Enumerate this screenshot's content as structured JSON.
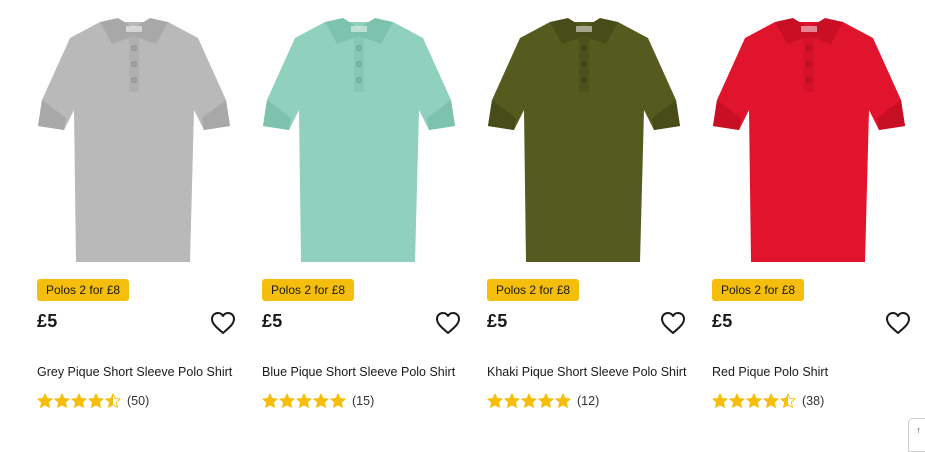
{
  "products": [
    {
      "image_alt": "Grey Pique Short Sleeve Polo Shirt",
      "shirt_color": "#b9b9b9",
      "shirt_shade": "#a8a8a8",
      "promo": "Polos 2 for £8",
      "price": "£5",
      "title": "Grey Pique Short Sleeve Polo Shirt",
      "rating": 4.5,
      "review_count": "(50)"
    },
    {
      "image_alt": "Blue Pique Short Sleeve Polo Shirt",
      "shirt_color": "#8fd1bc",
      "shirt_shade": "#7cc2ac",
      "promo": "Polos 2 for £8",
      "price": "£5",
      "title": "Blue Pique Short Sleeve Polo Shirt",
      "rating": 5,
      "review_count": "(15)"
    },
    {
      "image_alt": "Khaki Pique Short Sleeve Polo Shirt",
      "shirt_color": "#555a1f",
      "shirt_shade": "#474c18",
      "promo": "Polos 2 for £8",
      "price": "£5",
      "title": "Khaki Pique Short Sleeve Polo Shirt",
      "rating": 5,
      "review_count": "(12)"
    },
    {
      "image_alt": "Red Pique Polo Shirt",
      "shirt_color": "#e0152d",
      "shirt_shade": "#c80f24",
      "promo": "Polos 2 for £8",
      "price": "£5",
      "title": "Red Pique Polo Shirt",
      "rating": 4.5,
      "review_count": "(38)"
    }
  ],
  "colors": {
    "promo_bg": "#f5bd0c",
    "star": "#f5bd0c",
    "text": "#1a1a1a"
  },
  "icons": {
    "wishlist": "heart-outline-icon",
    "rating": "star-icon"
  },
  "corner_button": {
    "label": "↑"
  }
}
